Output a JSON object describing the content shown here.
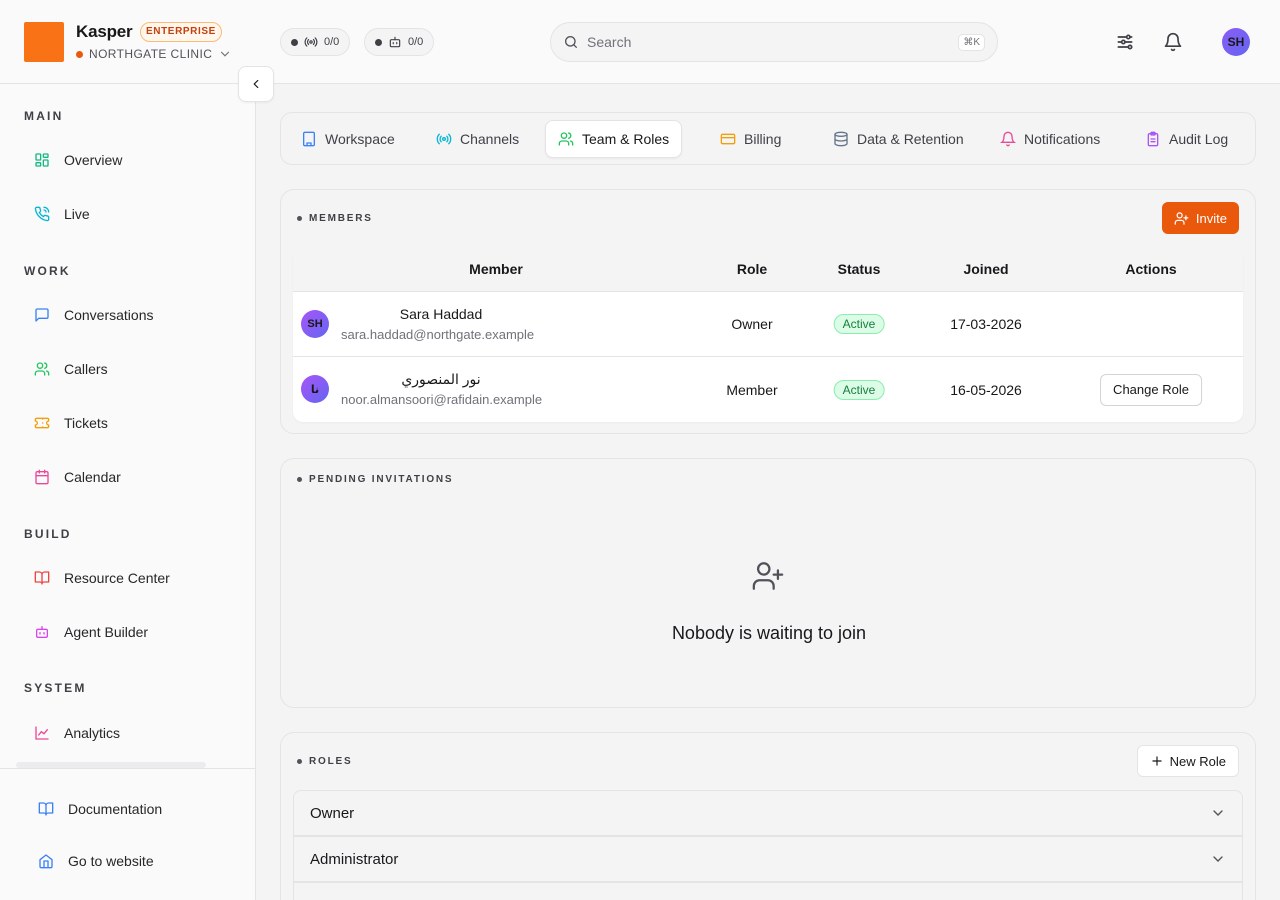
{
  "header": {
    "brand": "Kasper",
    "plan_badge": "ENTERPRISE",
    "org": "NORTHGATE CLINIC",
    "pills": [
      {
        "value": "0/0"
      },
      {
        "value": "0/0"
      }
    ],
    "search_placeholder": "Search",
    "search_shortcut": "⌘K",
    "avatar_initials": "SH"
  },
  "sidebar": {
    "sections": [
      "MAIN",
      "WORK",
      "BUILD",
      "SYSTEM"
    ],
    "items": [
      {
        "label": "Overview"
      },
      {
        "label": "Live"
      },
      {
        "label": "Conversations"
      },
      {
        "label": "Callers"
      },
      {
        "label": "Tickets"
      },
      {
        "label": "Calendar"
      },
      {
        "label": "Resource Center"
      },
      {
        "label": "Agent Builder"
      },
      {
        "label": "Analytics"
      }
    ],
    "footer": [
      {
        "label": "Documentation"
      },
      {
        "label": "Go to website"
      }
    ]
  },
  "tabs": [
    {
      "label": "Workspace"
    },
    {
      "label": "Channels"
    },
    {
      "label": "Team & Roles",
      "active": true
    },
    {
      "label": "Billing"
    },
    {
      "label": "Data & Retention"
    },
    {
      "label": "Notifications"
    },
    {
      "label": "Audit Log"
    }
  ],
  "members": {
    "title": "MEMBERS",
    "invite_label": "Invite",
    "columns": [
      "Member",
      "Role",
      "Status",
      "Joined",
      "Actions"
    ],
    "rows": [
      {
        "initials": "SH",
        "name": "Sara Haddad",
        "email": "sara.haddad@northgate.example",
        "role": "Owner",
        "status": "Active",
        "joined": "17-03-2026",
        "action": ""
      },
      {
        "initials": "نا",
        "name": "نور المنصوري",
        "email": "noor.almansoori@rafidain.example",
        "role": "Member",
        "status": "Active",
        "joined": "16-05-2026",
        "action": "Change Role"
      }
    ]
  },
  "invitations": {
    "title": "PENDING INVITATIONS",
    "empty_text": "Nobody is waiting to join"
  },
  "roles": {
    "title": "ROLES",
    "new_role_label": "New Role",
    "items": [
      {
        "name": "Owner"
      },
      {
        "name": "Administrator"
      }
    ]
  },
  "colors": {
    "accent": "#ea580c",
    "logo": "#f97316",
    "active_status": "#15803d"
  }
}
